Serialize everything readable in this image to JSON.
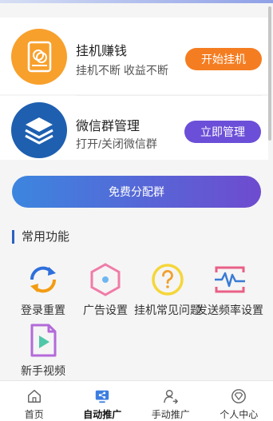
{
  "hang_card": {
    "title": "挂机赚钱",
    "subtitle": "挂机不断 收益不断",
    "button": "开始挂机",
    "icon": "phone-coin-icon"
  },
  "wechat_card": {
    "title": "微信群管理",
    "subtitle": "打开/关闭微信群",
    "button": "立即管理",
    "icon": "stack-layers-icon"
  },
  "assign_button": "免费分配群",
  "features_title": "常用功能",
  "features": [
    {
      "label": "登录重置",
      "icon": "refresh-arrows-icon"
    },
    {
      "label": "广告设置",
      "icon": "hexagon-icon"
    },
    {
      "label": "挂机常见问题",
      "icon": "question-icon"
    },
    {
      "label": "发送频率设置",
      "icon": "pulse-monitor-icon"
    },
    {
      "label": "新手视频",
      "icon": "video-file-icon"
    }
  ],
  "tabs": [
    {
      "label": "首页",
      "icon": "home-icon",
      "active": false
    },
    {
      "label": "自动推广",
      "icon": "monitor-share-icon",
      "active": true
    },
    {
      "label": "手动推广",
      "icon": "user-share-icon",
      "active": false
    },
    {
      "label": "个人中心",
      "icon": "diamond-icon",
      "active": false
    }
  ],
  "colors": {
    "orange": "#f57d21",
    "purple": "#6c4fd8",
    "blue": "#1e5fb0",
    "gradient_start": "#3c86df",
    "gradient_end": "#6e4bcf"
  }
}
